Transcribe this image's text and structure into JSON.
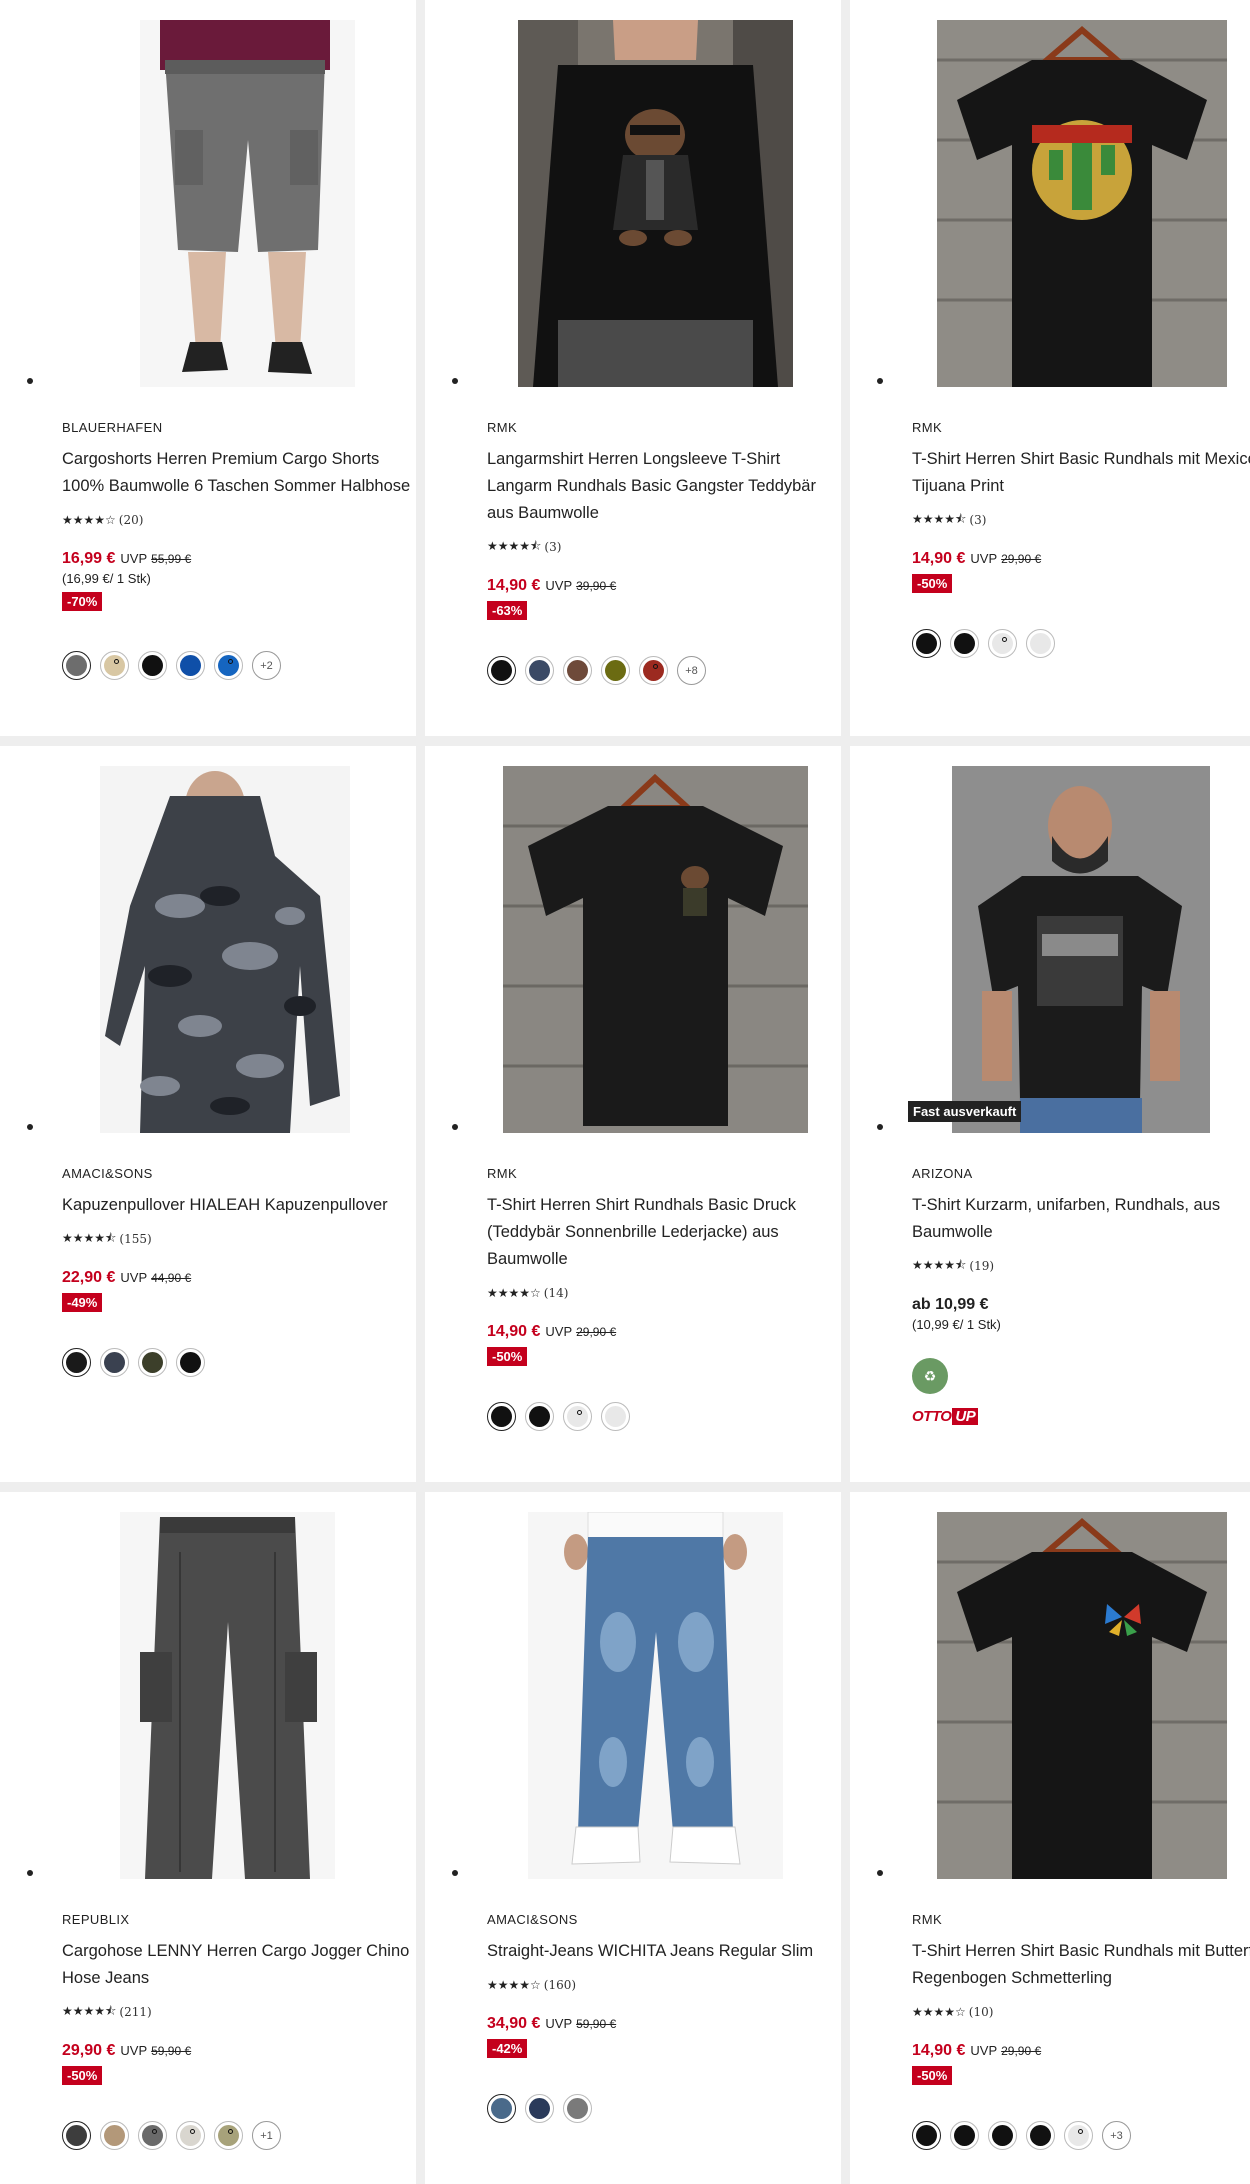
{
  "products": [
    {
      "brand": "BLAUERHAFEN",
      "title": "Cargoshorts Herren Premium Cargo Shorts 100% Baumwolle 6 Taschen Sommer Halbhose",
      "stars": "★★★★☆",
      "rating_count": "(20)",
      "price": "16,99 €",
      "uvp_label": "UVP",
      "old_price": "55,99 €",
      "unit_price": "(16,99 €/ 1 Stk)",
      "discount": "-70%",
      "swatch_colors": [
        "#6d6d6d",
        "#d8c7a3",
        "#111111",
        "#0f4fa8",
        "#1565c0"
      ],
      "more_colors": "+2"
    },
    {
      "brand": "RMK",
      "title": "Langarmshirt Herren Longsleeve T-Shirt Langarm Rundhals Basic Gangster Teddybär aus Baumwolle",
      "stars": "★★★★⯪",
      "rating_count": "(3)",
      "price": "14,90 €",
      "uvp_label": "UVP",
      "old_price": "39,90 €",
      "discount": "-63%",
      "swatch_colors": [
        "#111111",
        "#3b4a66",
        "#6e4a3a",
        "#6b6b12",
        "#9c2a20"
      ],
      "more_colors": "+8"
    },
    {
      "brand": "RMK",
      "title": "T-Shirt Herren Shirt Basic Rundhals mit Mexico Tijuana Print",
      "stars": "★★★★⯪",
      "rating_count": "(3)",
      "price": "14,90 €",
      "uvp_label": "UVP",
      "old_price": "29,90 €",
      "discount": "-50%",
      "swatch_colors": [
        "#111111",
        "#111111",
        "#e8e8e8",
        "#e8e8e8"
      ]
    },
    {
      "brand": "AMACI&SONS",
      "title": "Kapuzenpullover HIALEAH Kapuzenpullover",
      "stars": "★★★★⯪",
      "rating_count": "(155)",
      "price": "22,90 €",
      "uvp_label": "UVP",
      "old_price": "44,90 €",
      "discount": "-49%",
      "swatch_colors": [
        "#1a1a1a",
        "#3a4150",
        "#3c3f2a",
        "#111111"
      ]
    },
    {
      "brand": "RMK",
      "title": "T-Shirt Herren Shirt Rundhals Basic Druck (Teddybär Sonnenbrille Lederjacke) aus Baumwolle",
      "stars": "★★★★☆",
      "rating_count": "(14)",
      "price": "14,90 €",
      "uvp_label": "UVP",
      "old_price": "29,90 €",
      "discount": "-50%",
      "swatch_colors": [
        "#111111",
        "#111111",
        "#e8e8e8",
        "#e8e8e8"
      ]
    },
    {
      "brand": "ARIZONA",
      "title": "T-Shirt Kurzarm, unifarben, Rundhals, aus Baumwolle",
      "stars": "★★★★⯪",
      "rating_count": "(19)",
      "price": "ab 10,99 €",
      "unit_price": "(10,99 €/ 1 Stk)",
      "badge": "Fast ausverkauft",
      "logo_text_a": "OTTO",
      "logo_text_b": "UP"
    },
    {
      "brand": "REPUBLIX",
      "title": "Cargohose LENNY Herren Cargo Jogger Chino Hose Jeans",
      "stars": "★★★★⯪",
      "rating_count": "(211)",
      "price": "29,90 €",
      "uvp_label": "UVP",
      "old_price": "59,90 €",
      "discount": "-50%",
      "swatch_colors": [
        "#3d3d3d",
        "#b39879",
        "#6a6a6a",
        "#d9d6cf",
        "#a7a27a"
      ],
      "more_colors": "+1"
    },
    {
      "brand": "AMACI&SONS",
      "title": "Straight-Jeans WICHITA Jeans Regular Slim",
      "stars": "★★★★☆",
      "rating_count": "(160)",
      "price": "34,90 €",
      "uvp_label": "UVP",
      "old_price": "59,90 €",
      "discount": "-42%",
      "swatch_colors": [
        "#4a6a8a",
        "#2a3a5a",
        "#7a7a7a"
      ]
    },
    {
      "brand": "RMK",
      "title": "T-Shirt Herren Shirt Basic Rundhals mit Butterfly Regenbogen Schmetterling",
      "stars": "★★★★☆",
      "rating_count": "(10)",
      "price": "14,90 €",
      "uvp_label": "UVP",
      "old_price": "29,90 €",
      "discount": "-50%",
      "swatch_colors": [
        "#111111",
        "#111111",
        "#111111",
        "#111111",
        "#e8e8e8"
      ],
      "more_colors": "+3"
    }
  ]
}
